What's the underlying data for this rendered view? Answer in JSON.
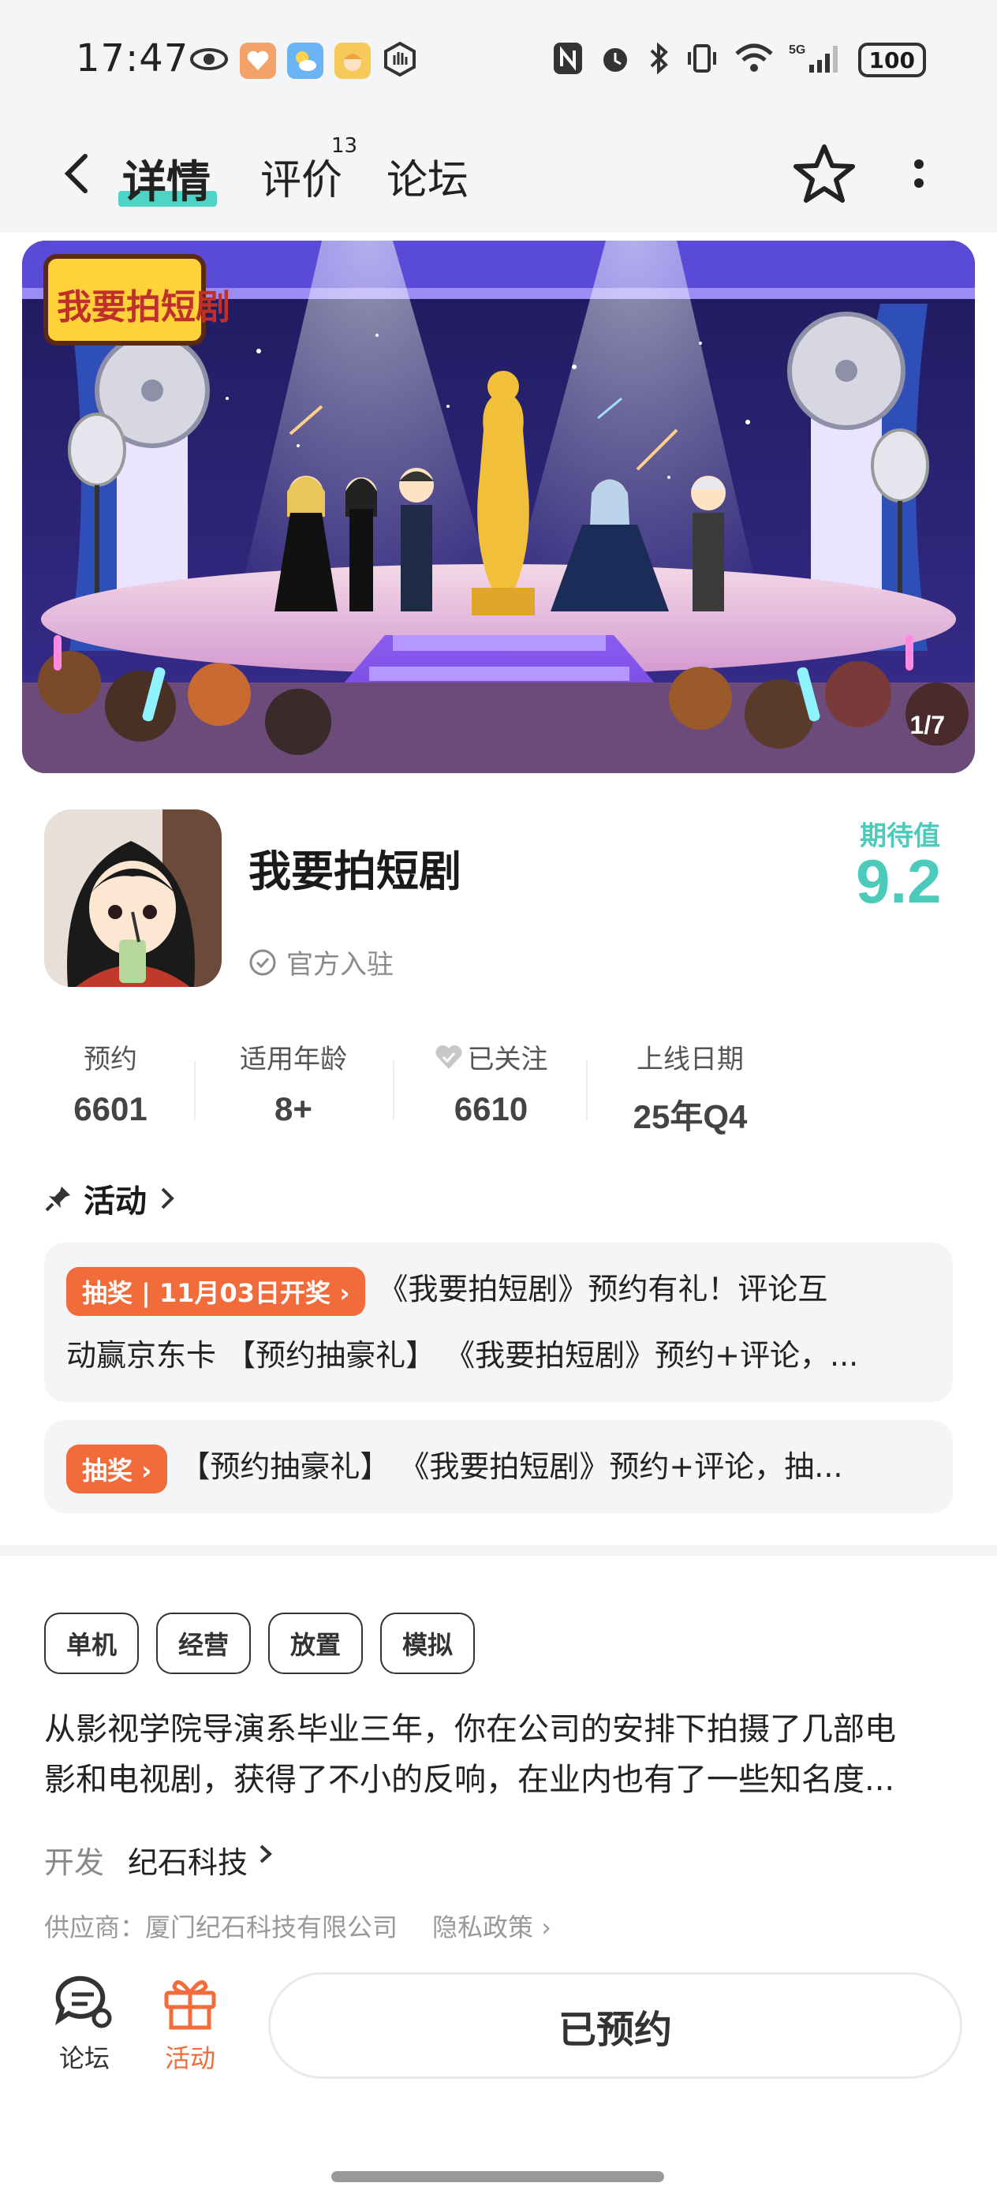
{
  "status": {
    "time": "17:47",
    "battery": "100",
    "network": "5G"
  },
  "nav": {
    "tabs": [
      "详情",
      "评价",
      "论坛"
    ],
    "review_count": "13"
  },
  "banner": {
    "counter": "1/7",
    "logo_text": "我要拍短剧"
  },
  "app": {
    "name": "我要拍短剧",
    "official": "官方入驻",
    "expect_label": "期待值",
    "expect_value": "9.2"
  },
  "stats": [
    {
      "label": "预约",
      "value": "6601"
    },
    {
      "label": "适用年龄",
      "value": "8+"
    },
    {
      "label": "已关注",
      "value": "6610"
    },
    {
      "label": "上线日期",
      "value": "25年Q4"
    }
  ],
  "activity": {
    "title": "活动",
    "items": [
      {
        "tag": "抽奖 | 11月03日开奖",
        "line1": "《我要拍短剧》预约有礼！评论互",
        "line2": "动赢京东卡 【预约抽豪礼】 《我要拍短剧》预约+评论，..."
      },
      {
        "tag": "抽奖",
        "line1": "【预约抽豪礼】 《我要拍短剧》预约+评论，抽..."
      }
    ]
  },
  "tags": [
    "单机",
    "经营",
    "放置",
    "模拟"
  ],
  "description": {
    "line1": "从影视学院导演系毕业三年，你在公司的安排下拍摄了几部电",
    "line2": "影和电视剧，获得了不小的反响，在业内也有了一些知名度..."
  },
  "developer": {
    "label": "开发",
    "name": "纪石科技"
  },
  "supplier": {
    "text": "供应商：厦门纪石科技有限公司",
    "privacy": "隐私政策"
  },
  "bottom": {
    "forum": "论坛",
    "activity": "活动",
    "reserve": "已预约"
  },
  "colors": {
    "accent_teal": "#4ccbbb",
    "accent_orange": "#f26b3a",
    "card_bg": "#f4f5f7"
  }
}
